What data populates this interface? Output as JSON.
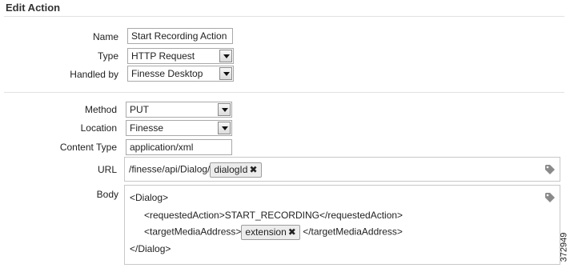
{
  "title": "Edit Action",
  "fields": {
    "name": {
      "label": "Name",
      "value": "Start Recording Action"
    },
    "type": {
      "label": "Type",
      "value": "HTTP Request"
    },
    "handled_by": {
      "label": "Handled by",
      "value": "Finesse Desktop"
    },
    "method": {
      "label": "Method",
      "value": "PUT"
    },
    "location": {
      "label": "Location",
      "value": "Finesse"
    },
    "content_type": {
      "label": "Content Type",
      "value": "application/xml"
    },
    "url": {
      "label": "URL",
      "prefix": "/finesse/api/Dialog/",
      "token": "dialogId"
    },
    "body": {
      "label": "Body",
      "line1": "<Dialog>",
      "line2": "<requestedAction>START_RECORDING</requestedAction>",
      "line3_prefix": "<targetMediaAddress>",
      "line3_token": "extension",
      "line3_suffix": "</targetMediaAddress>",
      "line4": "</Dialog>"
    }
  },
  "icons": {
    "token_remove": "x-icon",
    "variable_tag": "tag-icon"
  },
  "figure_number": "372949"
}
